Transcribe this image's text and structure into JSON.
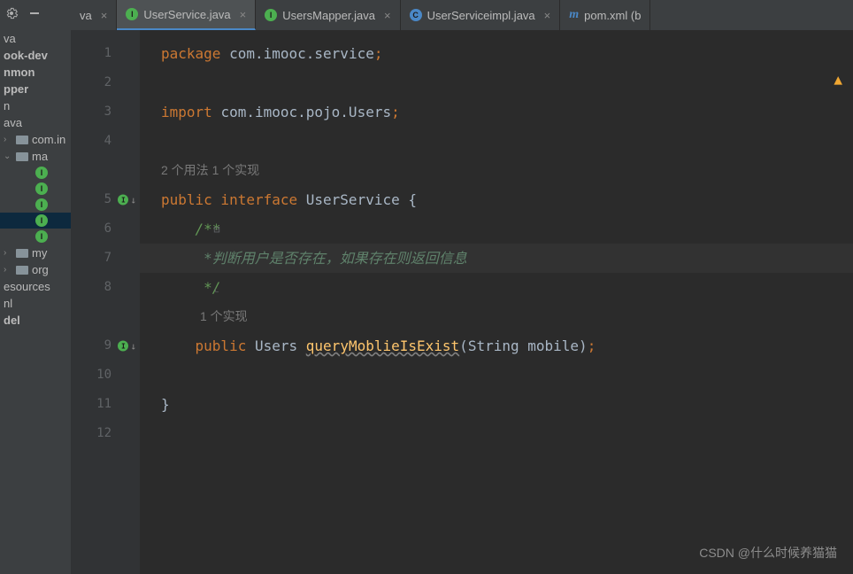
{
  "toolbar": {
    "settings_icon": "gear",
    "minimize_icon": "minimize"
  },
  "sidebar": {
    "items": [
      {
        "label": "va",
        "type": "text",
        "indent": 0
      },
      {
        "label": "ook-dev",
        "type": "text",
        "indent": 0,
        "bold": true
      },
      {
        "label": "nmon",
        "type": "text",
        "indent": 0,
        "bold": true
      },
      {
        "label": "pper",
        "type": "text",
        "indent": 0,
        "bold": true
      },
      {
        "label": "n",
        "type": "text",
        "indent": 0
      },
      {
        "label": "ava",
        "type": "text",
        "indent": 0
      },
      {
        "label": "com.in",
        "type": "folder",
        "indent": 0
      },
      {
        "label": "ma",
        "type": "folder",
        "indent": 0,
        "expanded": true
      },
      {
        "label": "",
        "type": "i",
        "indent": 2
      },
      {
        "label": "",
        "type": "i",
        "indent": 2
      },
      {
        "label": "",
        "type": "i",
        "indent": 2
      },
      {
        "label": "",
        "type": "i",
        "indent": 2,
        "highlighted": true
      },
      {
        "label": "",
        "type": "i",
        "indent": 2
      },
      {
        "label": "my",
        "type": "folder",
        "indent": 0
      },
      {
        "label": "org",
        "type": "folder",
        "indent": 0
      },
      {
        "label": "esources",
        "type": "text",
        "indent": 0
      },
      {
        "label": "nl",
        "type": "text",
        "indent": 0
      },
      {
        "label": "del",
        "type": "text",
        "indent": 0,
        "bold": true
      }
    ]
  },
  "tabs": [
    {
      "label": "va",
      "icon": "none",
      "active": false,
      "closable": true
    },
    {
      "label": "UserService.java",
      "icon": "i",
      "active": true,
      "closable": true
    },
    {
      "label": "UsersMapper.java",
      "icon": "i",
      "active": false,
      "closable": true
    },
    {
      "label": "UserServiceimpl.java",
      "icon": "c",
      "active": false,
      "closable": true
    },
    {
      "label": "pom.xml (b",
      "icon": "m",
      "active": false,
      "closable": false
    }
  ],
  "editor": {
    "hints": {
      "usage": "2 个用法",
      "impl": "1 个实现",
      "impl2": "1 个实现"
    },
    "lines": [
      {
        "n": 1,
        "tokens": [
          [
            "kw",
            "package"
          ],
          [
            "sp",
            " "
          ],
          [
            "pkg",
            "com.imooc.service"
          ],
          [
            "semi",
            ";"
          ]
        ]
      },
      {
        "n": 2,
        "tokens": []
      },
      {
        "n": 3,
        "tokens": [
          [
            "kw",
            "import"
          ],
          [
            "sp",
            " "
          ],
          [
            "pkg",
            "com.imooc.pojo.Users"
          ],
          [
            "semi",
            ";"
          ]
        ]
      },
      {
        "n": 4,
        "tokens": []
      },
      {
        "n": 5,
        "tokens": [
          [
            "kw",
            "public interface"
          ],
          [
            "sp",
            " "
          ],
          [
            "type",
            "UserService"
          ],
          [
            "sp",
            " "
          ],
          [
            "punct",
            "{"
          ]
        ],
        "marker": "impl"
      },
      {
        "n": 6,
        "tokens": [
          [
            "sp",
            "    "
          ],
          [
            "comment",
            "/**"
          ]
        ],
        "fold": "start"
      },
      {
        "n": 7,
        "tokens": [
          [
            "sp",
            "     "
          ],
          [
            "comment-text",
            "*判断用户是否存在，如果存在则返回信息"
          ]
        ],
        "current": true
      },
      {
        "n": 8,
        "tokens": [
          [
            "sp",
            "     "
          ],
          [
            "comment",
            "*/"
          ]
        ],
        "fold": "end"
      },
      {
        "n": 9,
        "tokens": [
          [
            "sp",
            "    "
          ],
          [
            "kw",
            "public"
          ],
          [
            "sp",
            " "
          ],
          [
            "type",
            "Users"
          ],
          [
            "sp",
            " "
          ],
          [
            "warn-method",
            "queryMoblieIsExist"
          ],
          [
            "punct",
            "("
          ],
          [
            "type",
            "String mobile"
          ],
          [
            "punct",
            ")"
          ],
          [
            "semi",
            ";"
          ]
        ],
        "marker": "impl"
      },
      {
        "n": 10,
        "tokens": []
      },
      {
        "n": 11,
        "tokens": [
          [
            "punct",
            "}"
          ]
        ]
      },
      {
        "n": 12,
        "tokens": []
      }
    ]
  },
  "watermark": "CSDN @什么时候养猫猫"
}
